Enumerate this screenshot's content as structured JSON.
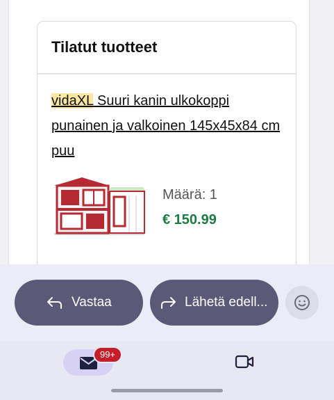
{
  "order": {
    "heading": "Tilatut tuotteet",
    "product": {
      "brand": "vidaXL",
      "title": " Suuri kanin ulkokoppi punainen ja valkoinen 145x45x84 cm puu",
      "quantity": "Määrä: 1",
      "price": "€ 150.99"
    }
  },
  "actions": {
    "reply_label": "Vastaa",
    "forward_label": "Lähetä edell..."
  },
  "tabs": {
    "mail_badge": "99+"
  },
  "icons": [
    "reply-arrow-icon",
    "forward-arrow-icon",
    "emoji-icon",
    "mail-icon",
    "video-icon"
  ],
  "colors": {
    "action_pill": "#5b5878",
    "price": "#1d7a46",
    "brand_highlight": "#fbe7a1",
    "badge": "#c41e2a"
  }
}
